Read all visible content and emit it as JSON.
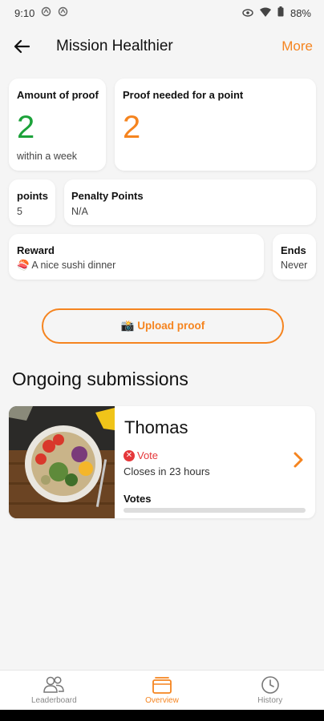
{
  "status_bar": {
    "time": "9:10",
    "battery": "88%",
    "icons": [
      "notification-icon",
      "notification-icon",
      "eye-icon",
      "wifi-icon",
      "battery-icon"
    ]
  },
  "app_bar": {
    "title": "Mission Healthier",
    "more_label": "More"
  },
  "stats": {
    "amount_of_proof": {
      "title": "Amount of proof",
      "value": "2",
      "subtitle": "within a week"
    },
    "proof_needed": {
      "title": "Proof needed for a point",
      "value": "2"
    },
    "points": {
      "title": "points",
      "value": "5"
    },
    "penalty_points": {
      "title": "Penalty Points",
      "value": "N/A"
    },
    "reward": {
      "title": "Reward",
      "value": "🍣 A nice sushi dinner"
    },
    "ends": {
      "title": "Ends",
      "value": "Never"
    }
  },
  "upload_button": {
    "label": "📸 Upload proof"
  },
  "section": {
    "title": "Ongoing submissions"
  },
  "submission": {
    "name": "Thomas",
    "vote_label": "Vote",
    "closes": "Closes in 23 hours",
    "votes_label": "Votes",
    "votes_progress": 0
  },
  "bottom_nav": [
    {
      "label": "Leaderboard",
      "icon": "people-icon",
      "active": false
    },
    {
      "label": "Overview",
      "icon": "overview-icon",
      "active": true
    },
    {
      "label": "History",
      "icon": "clock-icon",
      "active": false
    }
  ],
  "colors": {
    "accent": "#f5841f",
    "green": "#1ca23a",
    "error": "#e5373a",
    "background": "#f5f5f5"
  }
}
